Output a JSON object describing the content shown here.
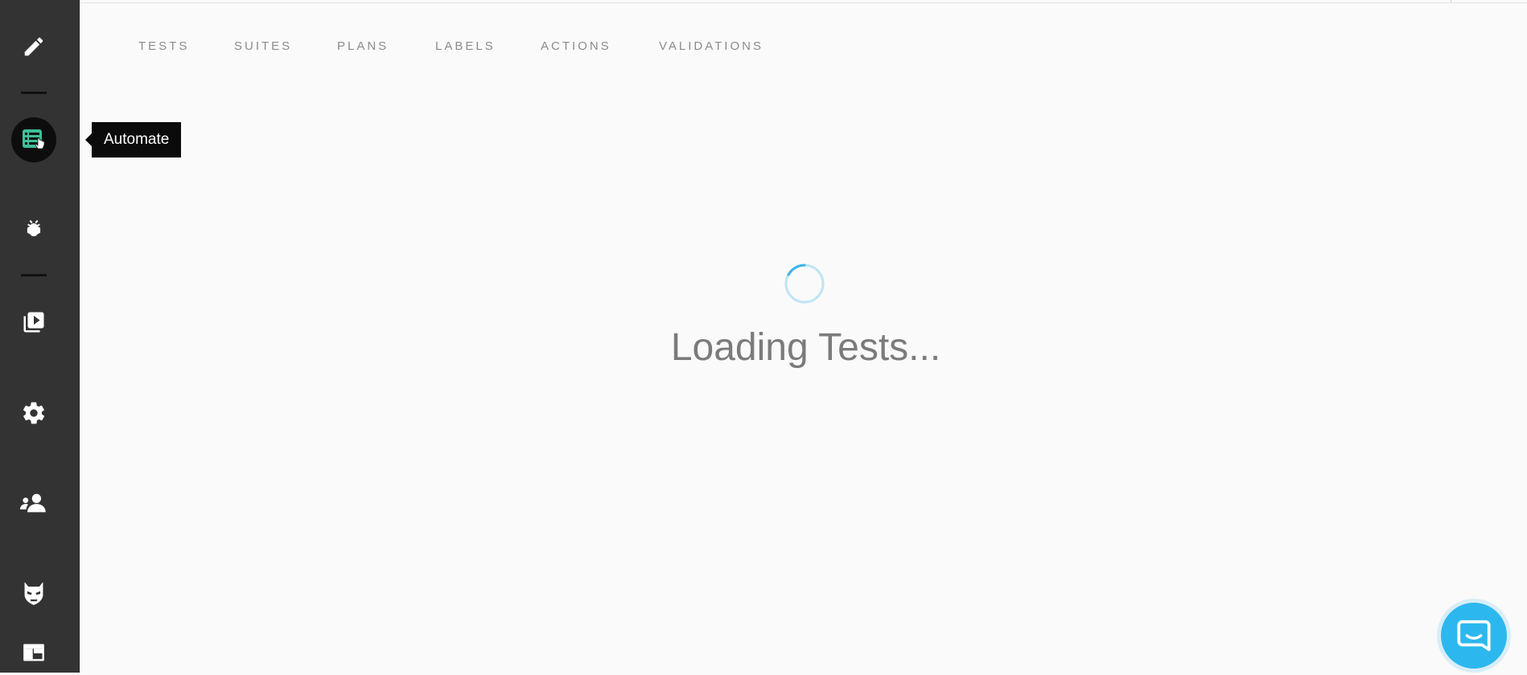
{
  "sidebar": {
    "items": [
      {
        "name": "edit",
        "icon": "pencil-icon"
      },
      {
        "name": "automate",
        "icon": "list-icon",
        "active": true
      },
      {
        "name": "bugs",
        "icon": "bug-icon"
      },
      {
        "name": "runs",
        "icon": "play-stack-icon"
      },
      {
        "name": "settings",
        "icon": "gear-icon"
      },
      {
        "name": "team",
        "icon": "users-icon"
      },
      {
        "name": "mask",
        "icon": "mask-icon"
      },
      {
        "name": "layout",
        "icon": "layout-icon"
      }
    ],
    "active_color": "#3dbf9a"
  },
  "tooltip": {
    "label": "Automate"
  },
  "tabs": [
    "TESTS",
    "SUITES",
    "PLANS",
    "LABELS",
    "ACTIONS",
    "VALIDATIONS"
  ],
  "loading": {
    "text": "Loading Tests...",
    "spinner_color": "#3cb4e8"
  },
  "chat": {
    "icon": "chat-icon",
    "color": "#2cb8ee"
  }
}
